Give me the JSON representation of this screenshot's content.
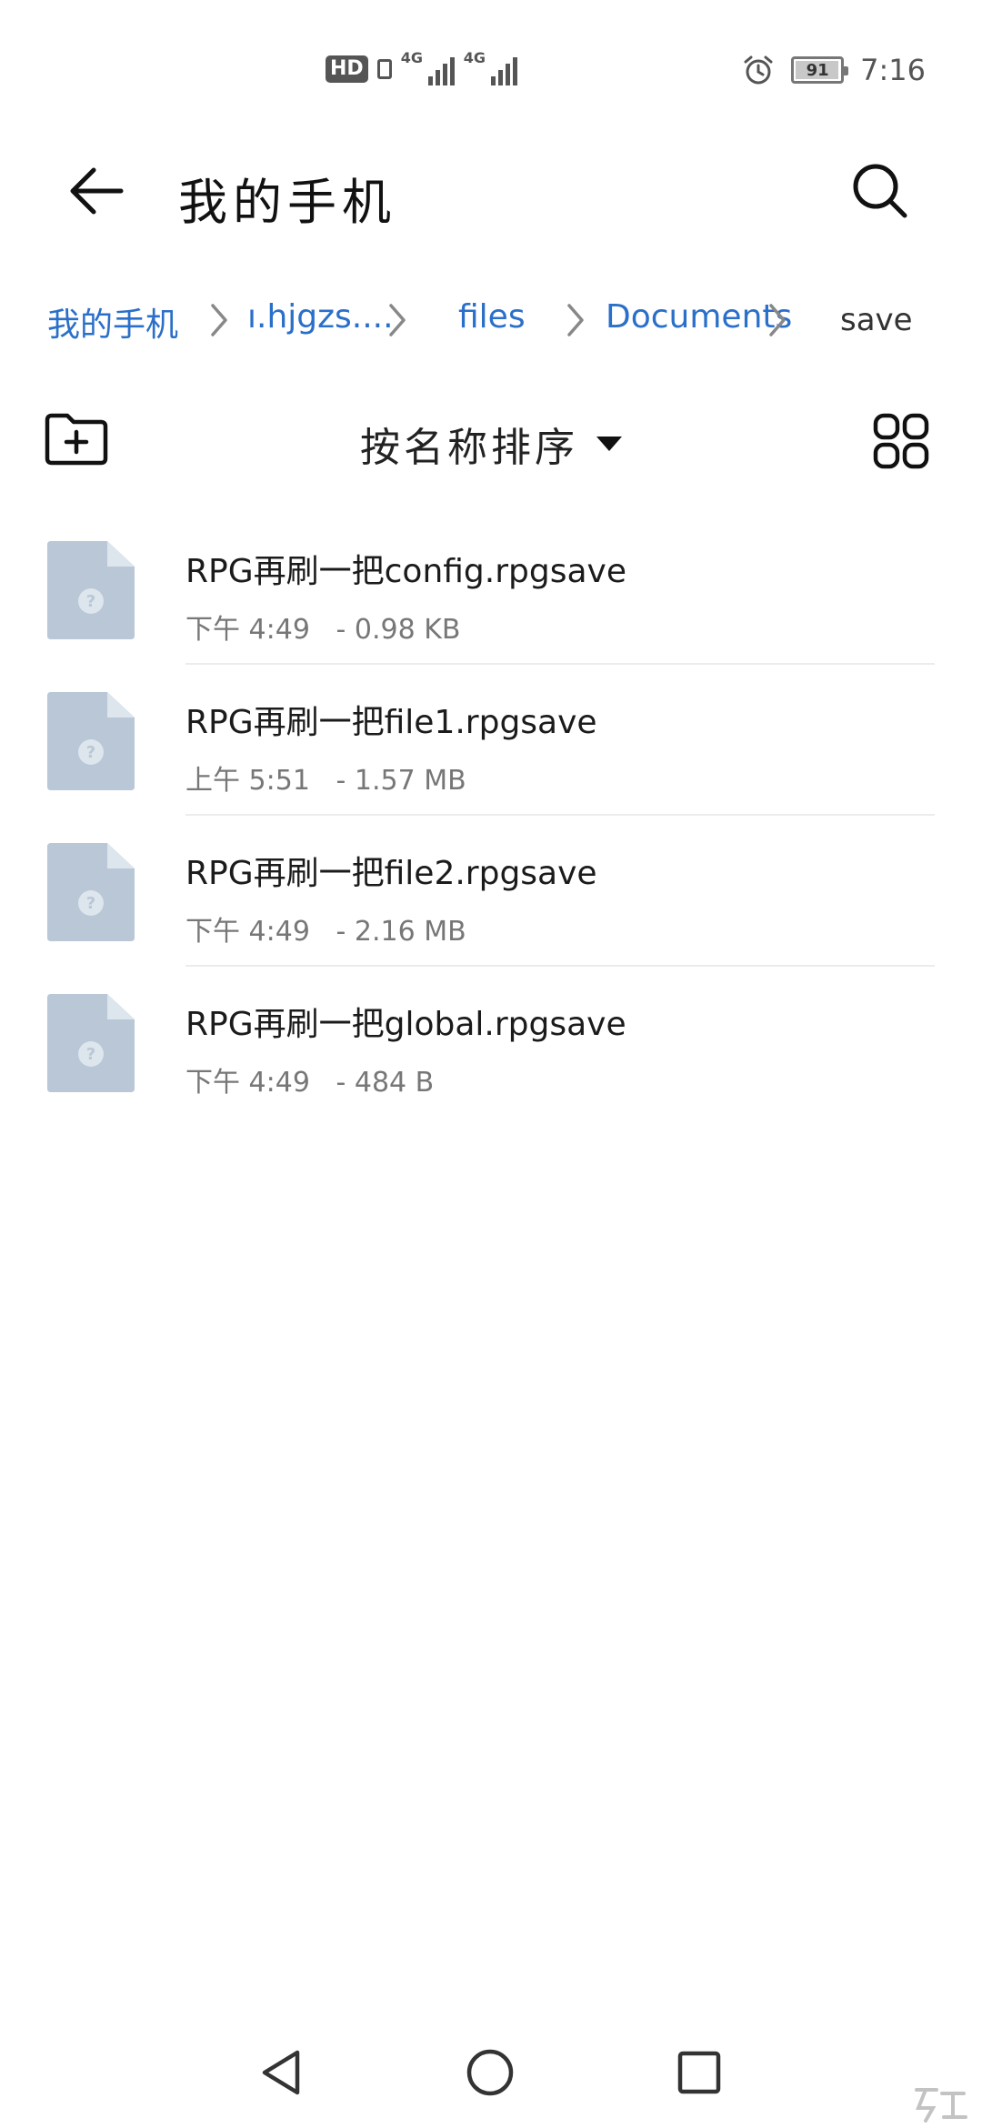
{
  "status_bar": {
    "hd_label": "HD",
    "network_1": "4G",
    "network_2": "4G",
    "battery_level": "91",
    "time": "7:16"
  },
  "header": {
    "title": "我的手机"
  },
  "breadcrumb": {
    "items": [
      "我的手机",
      "ı.hjgzs....",
      "files",
      "Documents",
      "save"
    ]
  },
  "toolbar": {
    "sort_label": "按名称排序"
  },
  "files": [
    {
      "name": "RPG再刷一把config.rpgsave",
      "time": "下午 4:49",
      "size": "- 0.98 KB"
    },
    {
      "name": "RPG再刷一把file1.rpgsave",
      "time": "上午 5:51",
      "size": "- 1.57 MB"
    },
    {
      "name": "RPG再刷一把file2.rpgsave",
      "time": "下午 4:49",
      "size": "- 2.16 MB"
    },
    {
      "name": "RPG再刷一把global.rpgsave",
      "time": "下午 4:49",
      "size": "- 484 B"
    }
  ],
  "colors": {
    "accent": "#2a6fc9",
    "file_icon": "#b9c7d6"
  }
}
